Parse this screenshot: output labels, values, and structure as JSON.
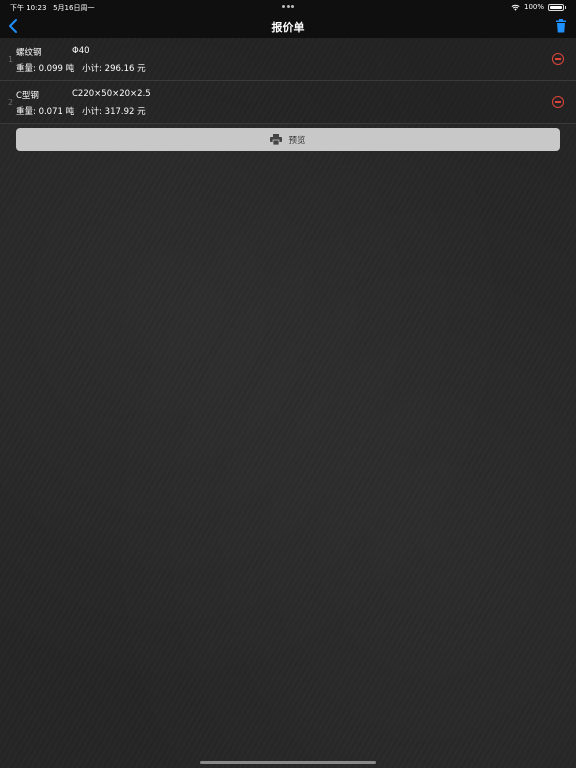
{
  "status_bar": {
    "time": "下午 10:23",
    "date": "5月16日周一",
    "battery": "100%",
    "icons": [
      "wifi-icon",
      "battery-icon"
    ]
  },
  "nav": {
    "title": "报价单",
    "back_icon": "chevron-left-icon",
    "trash_icon": "trash-icon",
    "accent": "#1e90ff"
  },
  "items": [
    {
      "index": "1",
      "name": "螺纹钢",
      "spec": "Φ40",
      "weight": "重量: 0.099 吨",
      "subtotal": "小计: 296.16 元"
    },
    {
      "index": "2",
      "name": "C型钢",
      "spec": "C220×50×20×2.5",
      "weight": "重量: 0.071 吨",
      "subtotal": "小计: 317.92 元"
    }
  ],
  "preview_button": {
    "label": "预览",
    "icon": "printer-icon"
  },
  "colors": {
    "remove": "#e0453a",
    "background": "#262626"
  }
}
